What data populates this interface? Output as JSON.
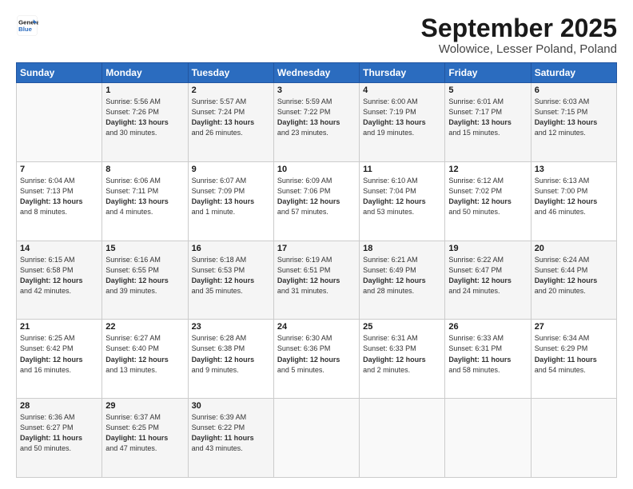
{
  "logo": {
    "line1": "General",
    "line2": "Blue"
  },
  "title": "September 2025",
  "subtitle": "Wolowice, Lesser Poland, Poland",
  "days_of_week": [
    "Sunday",
    "Monday",
    "Tuesday",
    "Wednesday",
    "Thursday",
    "Friday",
    "Saturday"
  ],
  "weeks": [
    [
      {
        "day": "",
        "info": ""
      },
      {
        "day": "1",
        "info": "Sunrise: 5:56 AM\nSunset: 7:26 PM\nDaylight: 13 hours\nand 30 minutes."
      },
      {
        "day": "2",
        "info": "Sunrise: 5:57 AM\nSunset: 7:24 PM\nDaylight: 13 hours\nand 26 minutes."
      },
      {
        "day": "3",
        "info": "Sunrise: 5:59 AM\nSunset: 7:22 PM\nDaylight: 13 hours\nand 23 minutes."
      },
      {
        "day": "4",
        "info": "Sunrise: 6:00 AM\nSunset: 7:19 PM\nDaylight: 13 hours\nand 19 minutes."
      },
      {
        "day": "5",
        "info": "Sunrise: 6:01 AM\nSunset: 7:17 PM\nDaylight: 13 hours\nand 15 minutes."
      },
      {
        "day": "6",
        "info": "Sunrise: 6:03 AM\nSunset: 7:15 PM\nDaylight: 13 hours\nand 12 minutes."
      }
    ],
    [
      {
        "day": "7",
        "info": "Sunrise: 6:04 AM\nSunset: 7:13 PM\nDaylight: 13 hours\nand 8 minutes."
      },
      {
        "day": "8",
        "info": "Sunrise: 6:06 AM\nSunset: 7:11 PM\nDaylight: 13 hours\nand 4 minutes."
      },
      {
        "day": "9",
        "info": "Sunrise: 6:07 AM\nSunset: 7:09 PM\nDaylight: 13 hours\nand 1 minute."
      },
      {
        "day": "10",
        "info": "Sunrise: 6:09 AM\nSunset: 7:06 PM\nDaylight: 12 hours\nand 57 minutes."
      },
      {
        "day": "11",
        "info": "Sunrise: 6:10 AM\nSunset: 7:04 PM\nDaylight: 12 hours\nand 53 minutes."
      },
      {
        "day": "12",
        "info": "Sunrise: 6:12 AM\nSunset: 7:02 PM\nDaylight: 12 hours\nand 50 minutes."
      },
      {
        "day": "13",
        "info": "Sunrise: 6:13 AM\nSunset: 7:00 PM\nDaylight: 12 hours\nand 46 minutes."
      }
    ],
    [
      {
        "day": "14",
        "info": "Sunrise: 6:15 AM\nSunset: 6:58 PM\nDaylight: 12 hours\nand 42 minutes."
      },
      {
        "day": "15",
        "info": "Sunrise: 6:16 AM\nSunset: 6:55 PM\nDaylight: 12 hours\nand 39 minutes."
      },
      {
        "day": "16",
        "info": "Sunrise: 6:18 AM\nSunset: 6:53 PM\nDaylight: 12 hours\nand 35 minutes."
      },
      {
        "day": "17",
        "info": "Sunrise: 6:19 AM\nSunset: 6:51 PM\nDaylight: 12 hours\nand 31 minutes."
      },
      {
        "day": "18",
        "info": "Sunrise: 6:21 AM\nSunset: 6:49 PM\nDaylight: 12 hours\nand 28 minutes."
      },
      {
        "day": "19",
        "info": "Sunrise: 6:22 AM\nSunset: 6:47 PM\nDaylight: 12 hours\nand 24 minutes."
      },
      {
        "day": "20",
        "info": "Sunrise: 6:24 AM\nSunset: 6:44 PM\nDaylight: 12 hours\nand 20 minutes."
      }
    ],
    [
      {
        "day": "21",
        "info": "Sunrise: 6:25 AM\nSunset: 6:42 PM\nDaylight: 12 hours\nand 16 minutes."
      },
      {
        "day": "22",
        "info": "Sunrise: 6:27 AM\nSunset: 6:40 PM\nDaylight: 12 hours\nand 13 minutes."
      },
      {
        "day": "23",
        "info": "Sunrise: 6:28 AM\nSunset: 6:38 PM\nDaylight: 12 hours\nand 9 minutes."
      },
      {
        "day": "24",
        "info": "Sunrise: 6:30 AM\nSunset: 6:36 PM\nDaylight: 12 hours\nand 5 minutes."
      },
      {
        "day": "25",
        "info": "Sunrise: 6:31 AM\nSunset: 6:33 PM\nDaylight: 12 hours\nand 2 minutes."
      },
      {
        "day": "26",
        "info": "Sunrise: 6:33 AM\nSunset: 6:31 PM\nDaylight: 11 hours\nand 58 minutes."
      },
      {
        "day": "27",
        "info": "Sunrise: 6:34 AM\nSunset: 6:29 PM\nDaylight: 11 hours\nand 54 minutes."
      }
    ],
    [
      {
        "day": "28",
        "info": "Sunrise: 6:36 AM\nSunset: 6:27 PM\nDaylight: 11 hours\nand 50 minutes."
      },
      {
        "day": "29",
        "info": "Sunrise: 6:37 AM\nSunset: 6:25 PM\nDaylight: 11 hours\nand 47 minutes."
      },
      {
        "day": "30",
        "info": "Sunrise: 6:39 AM\nSunset: 6:22 PM\nDaylight: 11 hours\nand 43 minutes."
      },
      {
        "day": "",
        "info": ""
      },
      {
        "day": "",
        "info": ""
      },
      {
        "day": "",
        "info": ""
      },
      {
        "day": "",
        "info": ""
      }
    ]
  ]
}
